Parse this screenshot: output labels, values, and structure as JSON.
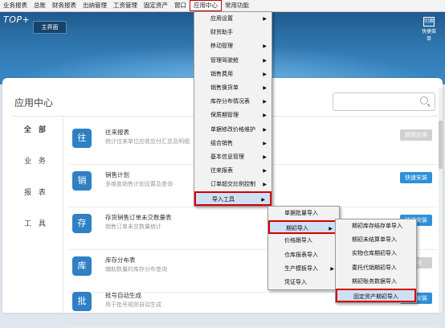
{
  "menubar": {
    "items": [
      "业务报表",
      "总账",
      "财务报表",
      "出纳管理",
      "工资管理",
      "固定资产",
      "窗口",
      "应用中心",
      "常用功能"
    ],
    "active_index": 7
  },
  "header": {
    "logo": "TOP+",
    "tab_main": "主界面",
    "corner_label": "快捷菜单",
    "corner_icon": "切换"
  },
  "panel": {
    "title": "应用中心",
    "search_placeholder": ""
  },
  "sidebar": {
    "categories": [
      "全 部",
      "业 务",
      "报 表",
      "工 具"
    ]
  },
  "apps": [
    {
      "title": "往来报表",
      "desc": "统计往来单位应收应付汇总及明细",
      "button": "即将应用",
      "button_style": "grey",
      "icon": "往"
    },
    {
      "title": "销售计划",
      "desc": "多维度销售计划设置及查询",
      "button": "快速安装",
      "button_style": "blue",
      "icon": "销"
    },
    {
      "title": "存货销售订单未交数量表",
      "desc": "销售订单未交数量统计",
      "button": "快速安装",
      "button_style": "blue",
      "icon": "存"
    },
    {
      "title": "库存分布表",
      "desc": "辅助数量的库存分布查询",
      "button": "应用",
      "button_style": "grey",
      "icon": "库"
    },
    {
      "title": "批号自动生成",
      "desc": "用于批号规则自动生成",
      "button": "快速安装",
      "button_style": "blue",
      "icon": "批"
    }
  ],
  "menu1": {
    "items": [
      {
        "label": "应用设置",
        "arrow": true
      },
      {
        "label": "财贸助手",
        "arrow": false
      },
      {
        "label": "移动管理",
        "arrow": true
      },
      {
        "label": "管理驾驶舱",
        "arrow": true
      },
      {
        "label": "销售费用",
        "arrow": true
      },
      {
        "label": "销售换货单",
        "arrow": true
      },
      {
        "label": "库存分布情况表",
        "arrow": true
      },
      {
        "label": "保质期管理",
        "arrow": true
      },
      {
        "label": "单据修改价格维护",
        "arrow": true
      },
      {
        "label": "组合销售",
        "arrow": true
      },
      {
        "label": "基本信息管理",
        "arrow": true
      },
      {
        "label": "往来报表",
        "arrow": true
      },
      {
        "label": "订单超交比例控制",
        "arrow": true
      },
      {
        "label": "导入工具",
        "arrow": true
      }
    ]
  },
  "menu2": {
    "items": [
      {
        "label": "单据批量导入",
        "arrow": false
      },
      {
        "label": "期初导入",
        "arrow": true
      },
      {
        "label": "价格跟导入",
        "arrow": false
      },
      {
        "label": "仓库报表导入",
        "arrow": false
      },
      {
        "label": "生产模板导入",
        "arrow": true
      },
      {
        "label": "凭证导入",
        "arrow": false
      }
    ]
  },
  "menu3": {
    "items": [
      {
        "label": "期初库存结存单导入",
        "arrow": false
      },
      {
        "label": "期初未结算单导入",
        "arrow": false
      },
      {
        "label": "实物仓库期初导入",
        "arrow": false
      },
      {
        "label": "委托代销期初导入",
        "arrow": false
      },
      {
        "label": "期初账务数据导入",
        "arrow": false
      },
      {
        "label": "固定资产期初导入",
        "arrow": false
      }
    ]
  }
}
